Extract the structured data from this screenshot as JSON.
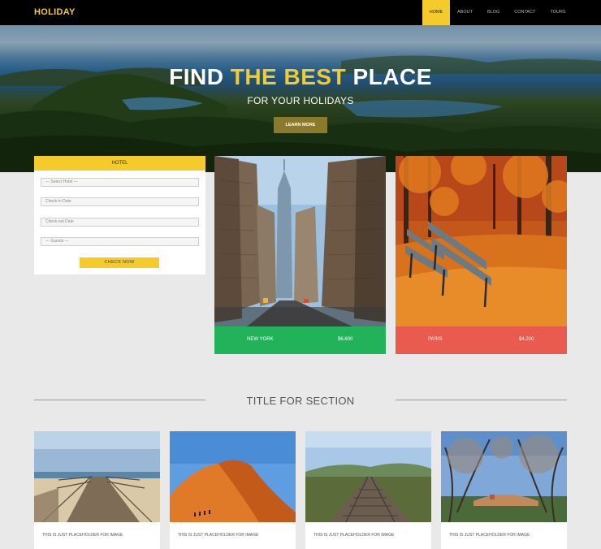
{
  "navbar": {
    "brand": "HOLIDAY",
    "items": [
      {
        "label": "HOME",
        "active": true
      },
      {
        "label": "ABOUT",
        "active": false
      },
      {
        "label": "BLOG",
        "active": false
      },
      {
        "label": "CONTACT",
        "active": false
      },
      {
        "label": "TOURS",
        "active": false
      }
    ]
  },
  "hero": {
    "title_part1": "FIND ",
    "title_highlight": "THE BEST",
    "title_part2": " PLACE",
    "subtitle": "FOR YOUR HOLIDAYS",
    "button_label": "LEARN MORE"
  },
  "booking_form": {
    "heading": "HOTEL",
    "hotel_select": "--- Select Hotel ---",
    "check_in_placeholder": "Check-in Date",
    "check_out_placeholder": "Check-out Date",
    "guests_select": "--- Guests ---",
    "submit_label": "CHECK NOW"
  },
  "destinations": [
    {
      "name": "NEW YORK",
      "price": "$6,600",
      "color": "#22b35a"
    },
    {
      "name": "PARIS",
      "price": "$4,200",
      "color": "#e95a4f"
    }
  ],
  "section": {
    "title": "TITLE FOR SECTION"
  },
  "gallery": [
    {
      "caption": "THIS IS JUST PLACEHOLDER FOR IMAGE"
    },
    {
      "caption": "THIS IS JUST PLACEHOLDER FOR IMAGE"
    },
    {
      "caption": "THIS IS JUST PLACEHOLDER FOR IMAGE"
    },
    {
      "caption": "THIS IS JUST PLACEHOLDER FOR IMAGE"
    }
  ],
  "colors": {
    "accent": "#f4cb2a",
    "navbar_bg": "#000000",
    "page_bg": "#e9e9e9",
    "new_york_bar": "#22b35a",
    "paris_bar": "#e95a4f",
    "hero_button": "#8b7a2c"
  }
}
